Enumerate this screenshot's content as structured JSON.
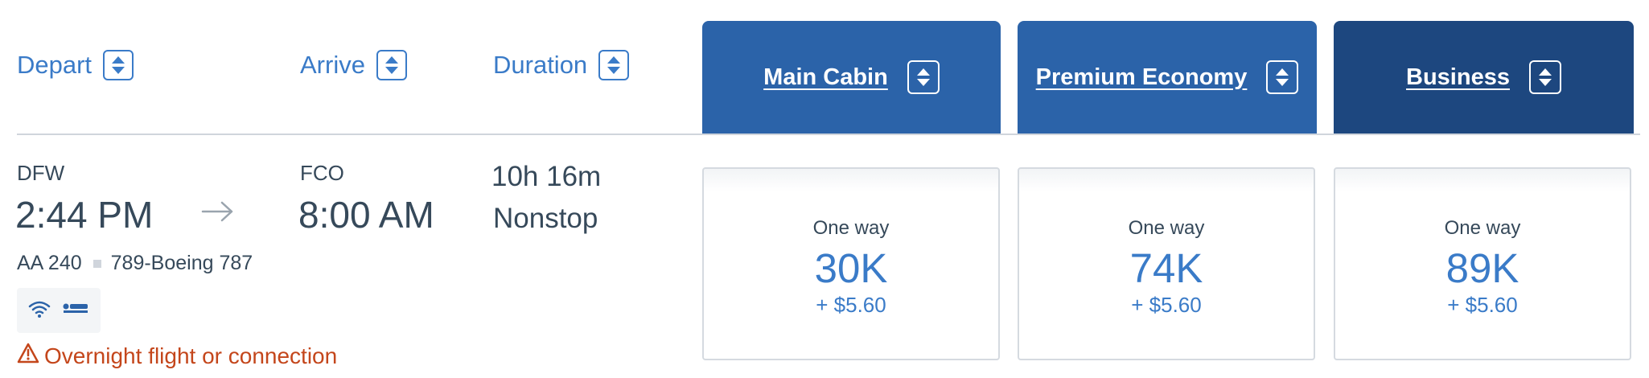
{
  "colors": {
    "link": "#3a7bc8",
    "main_cabin": "#2b63a9",
    "premium_economy": "#2b63a9",
    "business": "#1d477f",
    "warning": "#c4461b"
  },
  "sort_headers": {
    "depart": "Depart",
    "arrive": "Arrive",
    "duration": "Duration"
  },
  "cabins": [
    {
      "label": "Main Cabin"
    },
    {
      "label": "Premium Economy"
    },
    {
      "label": "Business"
    }
  ],
  "flight": {
    "origin": "DFW",
    "depart_time": "2:44 PM",
    "destination": "FCO",
    "arrive_time": "8:00 AM",
    "duration": "10h 16m",
    "stops": "Nonstop",
    "flight_number": "AA 240",
    "aircraft": "789-Boeing 787",
    "amenities": [
      "wifi-icon",
      "lie-flat-seat-icon"
    ],
    "warning": "Overnight flight or connection"
  },
  "fares": [
    {
      "label": "One way",
      "miles": "30K",
      "taxes": "+ $5.60"
    },
    {
      "label": "One way",
      "miles": "74K",
      "taxes": "+ $5.60"
    },
    {
      "label": "One way",
      "miles": "89K",
      "taxes": "+ $5.60"
    }
  ]
}
